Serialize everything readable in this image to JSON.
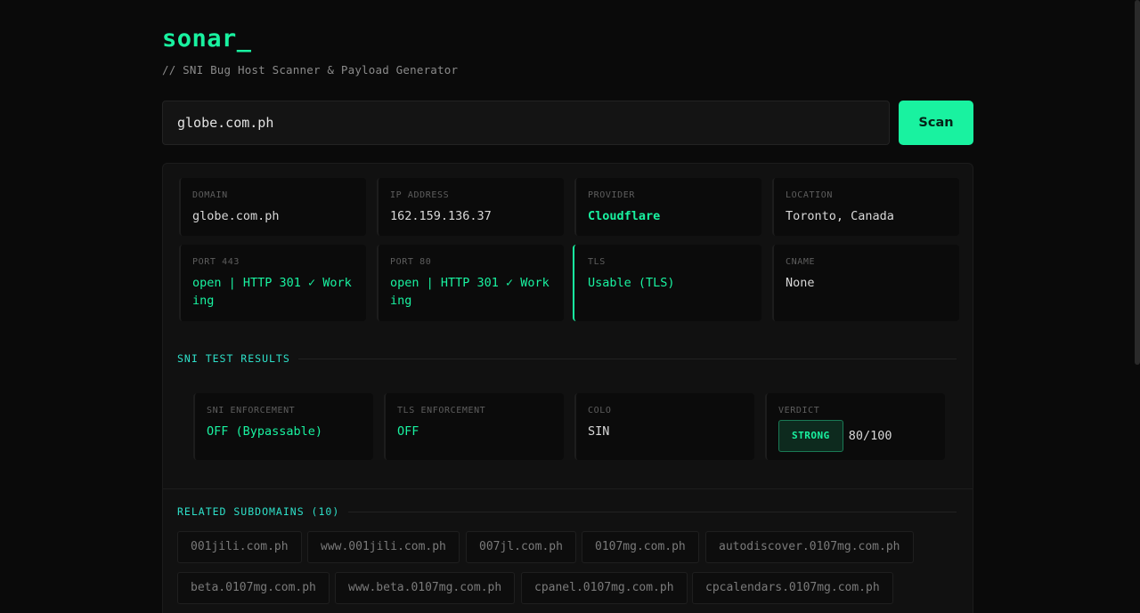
{
  "header": {
    "title": "sonar_",
    "subtitle": "// SNI Bug Host Scanner & Payload Generator"
  },
  "search": {
    "value": "globe.com.ph",
    "button_label": "Scan"
  },
  "info_cards": [
    {
      "label": "DOMAIN",
      "value": "globe.com.ph"
    },
    {
      "label": "IP ADDRESS",
      "value": "162.159.136.37"
    },
    {
      "label": "PROVIDER",
      "value": "Cloudflare"
    },
    {
      "label": "LOCATION",
      "value": "Toronto, Canada"
    },
    {
      "label": "PORT 443",
      "value": "open | HTTP 301 ✓ Working"
    },
    {
      "label": "PORT 80",
      "value": "open | HTTP 301 ✓ Working"
    },
    {
      "label": "TLS",
      "value": "Usable (TLS)"
    },
    {
      "label": "CNAME",
      "value": "None"
    }
  ],
  "sni": {
    "title": "SNI TEST RESULTS",
    "cards": [
      {
        "label": "SNI ENFORCEMENT",
        "value": "OFF (Bypassable)"
      },
      {
        "label": "TLS ENFORCEMENT",
        "value": "OFF"
      },
      {
        "label": "COLO",
        "value": "SIN"
      },
      {
        "label": "VERDICT",
        "badge": "STRONG",
        "score": "80/100"
      }
    ]
  },
  "subdomains": {
    "title": "RELATED SUBDOMAINS (10)",
    "items": [
      "001jili.com.ph",
      "www.001jili.com.ph",
      "007jl.com.ph",
      "0107mg.com.ph",
      "autodiscover.0107mg.com.ph",
      "beta.0107mg.com.ph",
      "www.beta.0107mg.com.ph",
      "cpanel.0107mg.com.ph",
      "cpcalendars.0107mg.com.ph"
    ]
  },
  "colors": {
    "accent": "#19f2a0",
    "section": "#2ee0c9",
    "background": "#0a0a0a"
  }
}
